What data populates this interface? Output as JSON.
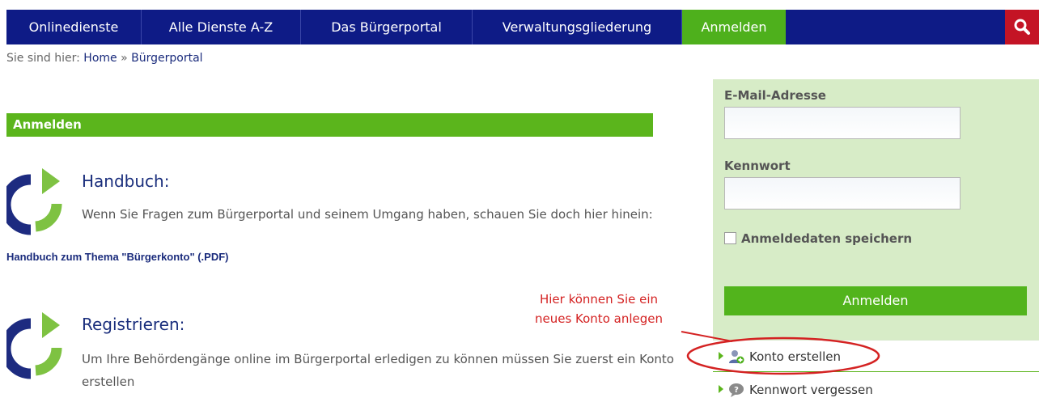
{
  "nav": {
    "tabs": [
      {
        "label": "Onlinedienste"
      },
      {
        "label": "Alle Dienste A-Z"
      },
      {
        "label": "Das Bürgerportal"
      },
      {
        "label": "Verwaltungsgliederung"
      },
      {
        "label": "Anmelden"
      }
    ],
    "active_index": 4
  },
  "breadcrumb": {
    "prefix": "Sie sind hier:",
    "home": "Home",
    "separator": "»",
    "current": "Bürgerportal"
  },
  "section": {
    "title": "Anmelden"
  },
  "handbuch": {
    "title": "Handbuch:",
    "text": "Wenn Sie Fragen zum Bürgerportal und seinem Umgang haben, schauen Sie doch hier hinein:",
    "link": "Handbuch zum Thema \"Bürgerkonto\" (.PDF)"
  },
  "registrieren": {
    "title": "Registrieren:",
    "text": "Um Ihre Behördengänge online im Bürgerportal erledigen zu können müssen Sie zuerst ein Konto erstellen"
  },
  "annotation": {
    "line1": "Hier können Sie ein",
    "line2": "neues Konto anlegen"
  },
  "login": {
    "email_label": "E-Mail-Adresse",
    "email_value": "",
    "password_label": "Kennwort",
    "password_value": "",
    "remember_label": "Anmeldedaten speichern",
    "remember_checked": false,
    "submit_label": "Anmelden"
  },
  "links": {
    "create_account": "Konto erstellen",
    "forgot_password": "Kennwort vergessen"
  },
  "icons": {
    "search": "search-icon",
    "logo": "portal-logo-icon",
    "user_add": "user-add-icon",
    "help": "help-icon"
  },
  "colors": {
    "nav_blue": "#0e1b86",
    "accent_green": "#5bb51c",
    "panel_green": "#d7ecc7",
    "search_red": "#c41425",
    "annotation_red": "#d42222"
  }
}
